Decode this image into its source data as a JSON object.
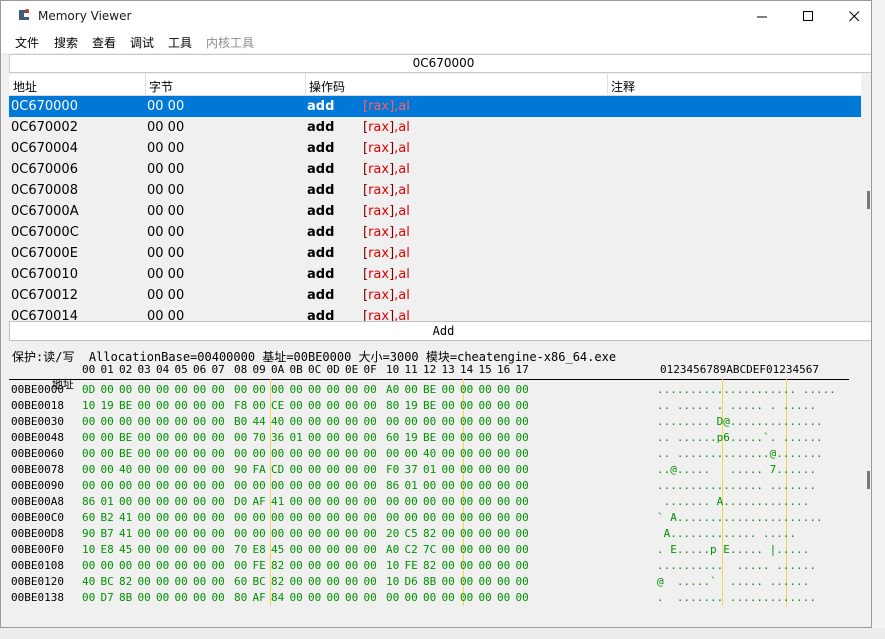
{
  "window": {
    "title": "Memory Viewer",
    "icon": "cheat-engine-icon",
    "controls": {
      "minimize": "minimize-icon",
      "maximize": "maximize-icon",
      "close": "close-icon"
    }
  },
  "menu": [
    "文件",
    "搜索",
    "查看",
    "调试",
    "工具",
    "内核工具"
  ],
  "address_bar": "0C670000",
  "disasm": {
    "headers": [
      "地址",
      "字节",
      "操作码",
      "注释"
    ],
    "rows": [
      {
        "addr": "0C670000",
        "bytes": "00 00",
        "op": "add",
        "arg_open": "[",
        "arg_reg": "rax",
        "arg_close": "]",
        "arg_rest": ",al"
      },
      {
        "addr": "0C670002",
        "bytes": "00 00",
        "op": "add",
        "arg_open": "[",
        "arg_reg": "rax",
        "arg_close": "]",
        "arg_rest": ",al"
      },
      {
        "addr": "0C670004",
        "bytes": "00 00",
        "op": "add",
        "arg_open": "[",
        "arg_reg": "rax",
        "arg_close": "]",
        "arg_rest": ",al"
      },
      {
        "addr": "0C670006",
        "bytes": "00 00",
        "op": "add",
        "arg_open": "[",
        "arg_reg": "rax",
        "arg_close": "]",
        "arg_rest": ",al"
      },
      {
        "addr": "0C670008",
        "bytes": "00 00",
        "op": "add",
        "arg_open": "[",
        "arg_reg": "rax",
        "arg_close": "]",
        "arg_rest": ",al"
      },
      {
        "addr": "0C67000A",
        "bytes": "00 00",
        "op": "add",
        "arg_open": "[",
        "arg_reg": "rax",
        "arg_close": "]",
        "arg_rest": ",al"
      },
      {
        "addr": "0C67000C",
        "bytes": "00 00",
        "op": "add",
        "arg_open": "[",
        "arg_reg": "rax",
        "arg_close": "]",
        "arg_rest": ",al"
      },
      {
        "addr": "0C67000E",
        "bytes": "00 00",
        "op": "add",
        "arg_open": "[",
        "arg_reg": "rax",
        "arg_close": "]",
        "arg_rest": ",al"
      },
      {
        "addr": "0C670010",
        "bytes": "00 00",
        "op": "add",
        "arg_open": "[",
        "arg_reg": "rax",
        "arg_close": "]",
        "arg_rest": ",al"
      },
      {
        "addr": "0C670012",
        "bytes": "00 00",
        "op": "add",
        "arg_open": "[",
        "arg_reg": "rax",
        "arg_close": "]",
        "arg_rest": ",al"
      },
      {
        "addr": "0C670014",
        "bytes": "00 00",
        "op": "add",
        "arg_open": "[",
        "arg_reg": "rax",
        "arg_close": "]",
        "arg_rest": ",al"
      }
    ],
    "selected_index": 0
  },
  "add_bar": "Add",
  "hex": {
    "info": "保护:读/写  AllocationBase=00400000 基址=00BE0000 大小=3000 模块=cheatengine-x86_64.exe",
    "header_addr": "地址",
    "col_headers": [
      "00",
      "01",
      "02",
      "03",
      "04",
      "05",
      "06",
      "07",
      "08",
      "09",
      "0A",
      "0B",
      "0C",
      "0D",
      "0E",
      "0F",
      "10",
      "11",
      "12",
      "13",
      "14",
      "15",
      "16",
      "17"
    ],
    "ascii_header": "0123456789ABCDEF01234567",
    "rows": [
      {
        "addr": "00BE0000",
        "bytes": [
          "0D",
          "00",
          "00",
          "00",
          "00",
          "00",
          "00",
          "00",
          "00",
          "00",
          "00",
          "00",
          "00",
          "00",
          "00",
          "00",
          "A0",
          "00",
          "BE",
          "00",
          "00",
          "00",
          "00",
          "00"
        ],
        "ascii": "..................... ....."
      },
      {
        "addr": "00BE0018",
        "bytes": [
          "10",
          "19",
          "BE",
          "00",
          "00",
          "00",
          "00",
          "00",
          "F8",
          "00",
          "CE",
          "00",
          "00",
          "00",
          "00",
          "00",
          "80",
          "19",
          "BE",
          "00",
          "00",
          "00",
          "00",
          "00"
        ],
        "ascii": ".. ..... . ..... . ....."
      },
      {
        "addr": "00BE0030",
        "bytes": [
          "00",
          "00",
          "00",
          "00",
          "00",
          "00",
          "00",
          "00",
          "B0",
          "44",
          "40",
          "00",
          "00",
          "00",
          "00",
          "00",
          "00",
          "00",
          "00",
          "00",
          "00",
          "00",
          "00",
          "00"
        ],
        "ascii": "........ D@.............."
      },
      {
        "addr": "00BE0048",
        "bytes": [
          "00",
          "00",
          "BE",
          "00",
          "00",
          "00",
          "00",
          "00",
          "00",
          "70",
          "36",
          "01",
          "00",
          "00",
          "00",
          "00",
          "60",
          "19",
          "BE",
          "00",
          "00",
          "00",
          "00",
          "00"
        ],
        "ascii": ".. ......p6.....`. ......"
      },
      {
        "addr": "00BE0060",
        "bytes": [
          "00",
          "00",
          "BE",
          "00",
          "00",
          "00",
          "00",
          "00",
          "00",
          "00",
          "00",
          "00",
          "00",
          "00",
          "00",
          "00",
          "00",
          "00",
          "40",
          "00",
          "00",
          "00",
          "00",
          "00"
        ],
        "ascii": ".. ..............@......."
      },
      {
        "addr": "00BE0078",
        "bytes": [
          "00",
          "00",
          "40",
          "00",
          "00",
          "00",
          "00",
          "00",
          "90",
          "FA",
          "CD",
          "00",
          "00",
          "00",
          "00",
          "00",
          "F0",
          "37",
          "01",
          "00",
          "00",
          "00",
          "00",
          "00"
        ],
        "ascii": "..@.....   ..... 7......"
      },
      {
        "addr": "00BE0090",
        "bytes": [
          "00",
          "00",
          "00",
          "00",
          "00",
          "00",
          "00",
          "00",
          "00",
          "00",
          "00",
          "00",
          "00",
          "00",
          "00",
          "00",
          "86",
          "01",
          "00",
          "00",
          "00",
          "00",
          "00",
          "00"
        ],
        "ascii": "................ ......."
      },
      {
        "addr": "00BE00A8",
        "bytes": [
          "86",
          "01",
          "00",
          "00",
          "00",
          "00",
          "00",
          "00",
          "D0",
          "AF",
          "41",
          "00",
          "00",
          "00",
          "00",
          "00",
          "00",
          "00",
          "00",
          "00",
          "00",
          "00",
          "00",
          "00"
        ],
        "ascii": " ....... A............."
      },
      {
        "addr": "00BE00C0",
        "bytes": [
          "60",
          "B2",
          "41",
          "00",
          "00",
          "00",
          "00",
          "00",
          "00",
          "00",
          "00",
          "00",
          "00",
          "00",
          "00",
          "00",
          "00",
          "00",
          "00",
          "00",
          "00",
          "00",
          "00",
          "00"
        ],
        "ascii": "` A......................"
      },
      {
        "addr": "00BE00D8",
        "bytes": [
          "90",
          "B7",
          "41",
          "00",
          "00",
          "00",
          "00",
          "00",
          "00",
          "00",
          "00",
          "00",
          "00",
          "00",
          "00",
          "00",
          "20",
          "C5",
          "82",
          "00",
          "00",
          "00",
          "00",
          "00"
        ],
        "ascii": " A............. ....."
      },
      {
        "addr": "00BE00F0",
        "bytes": [
          "10",
          "E8",
          "45",
          "00",
          "00",
          "00",
          "00",
          "00",
          "70",
          "E8",
          "45",
          "00",
          "00",
          "00",
          "00",
          "00",
          "A0",
          "C2",
          "7C",
          "00",
          "00",
          "00",
          "00",
          "00"
        ],
        "ascii": ". E.....p E..... |....."
      },
      {
        "addr": "00BE0108",
        "bytes": [
          "00",
          "00",
          "00",
          "00",
          "00",
          "00",
          "00",
          "00",
          "00",
          "FE",
          "82",
          "00",
          "00",
          "00",
          "00",
          "00",
          "10",
          "FE",
          "82",
          "00",
          "00",
          "00",
          "00",
          "00"
        ],
        "ascii": "..........  ..... ......"
      },
      {
        "addr": "00BE0120",
        "bytes": [
          "40",
          "BC",
          "82",
          "00",
          "00",
          "00",
          "00",
          "00",
          "60",
          "BC",
          "82",
          "00",
          "00",
          "00",
          "00",
          "00",
          "10",
          "D6",
          "8B",
          "00",
          "00",
          "00",
          "00",
          "00"
        ],
        "ascii": "@  .....`  ..... ......"
      },
      {
        "addr": "00BE0138",
        "bytes": [
          "00",
          "D7",
          "8B",
          "00",
          "00",
          "00",
          "00",
          "00",
          "80",
          "AF",
          "84",
          "00",
          "00",
          "00",
          "00",
          "00",
          "00",
          "00",
          "00",
          "00",
          "00",
          "00",
          "00",
          "00"
        ],
        "ascii": ".  ....... ............."
      }
    ]
  }
}
